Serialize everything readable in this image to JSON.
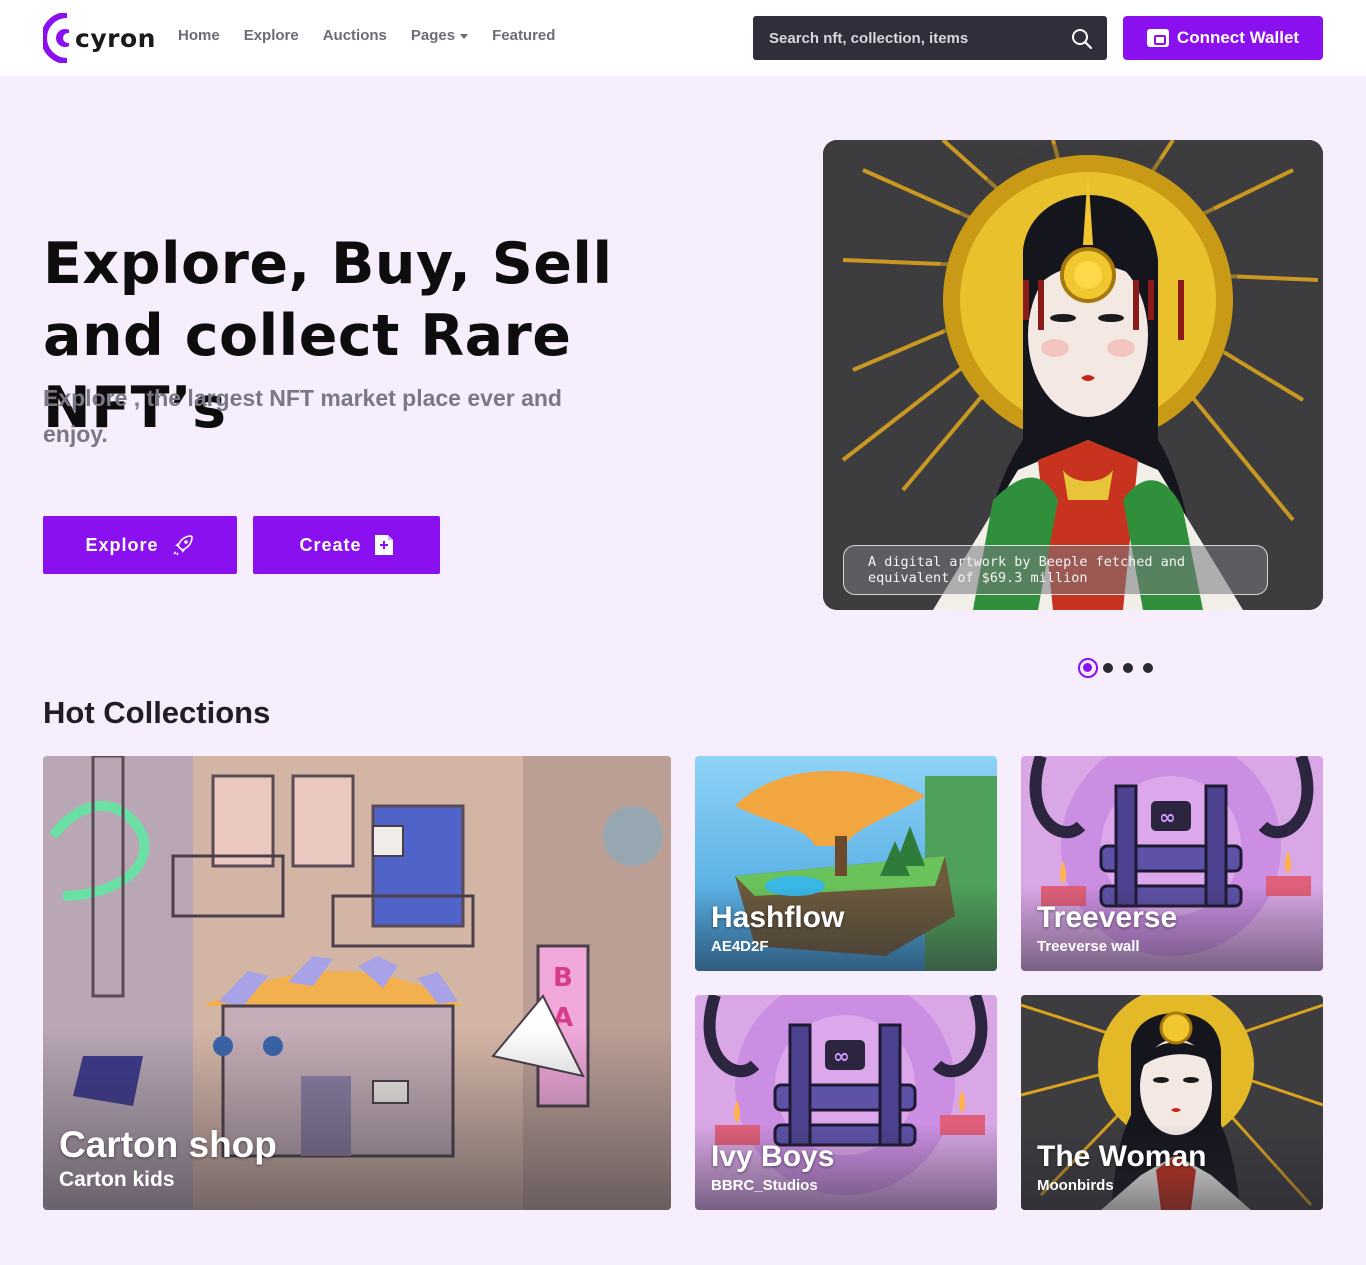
{
  "brand": {
    "name": "cyron",
    "accent": "#8a10f0"
  },
  "nav": {
    "items": [
      {
        "label": "Home"
      },
      {
        "label": "Explore"
      },
      {
        "label": "Auctions"
      },
      {
        "label": "Pages",
        "has_dropdown": true
      },
      {
        "label": "Featured"
      }
    ]
  },
  "search": {
    "placeholder": "Search nft, collection, items",
    "icon": "search-icon"
  },
  "wallet": {
    "label": "Connect Wallet",
    "icon": "wallet-icon"
  },
  "hero": {
    "title": "Explore, Buy, Sell and collect Rare NFT’s",
    "subtitle": "Explore , the largest NFT market place ever and enjoy.",
    "explore_label": "Explore",
    "create_label": "Create",
    "explore_icon": "rocket-icon",
    "create_icon": "add-file-icon",
    "caption": "A digital artwork by Beeple fetched and equivalent of $69.3 million",
    "slides_total": 4,
    "active_slide": 1
  },
  "collections": {
    "title": "Hot Collections",
    "cards": [
      {
        "title": "Carton shop",
        "subtitle": "Carton kids"
      },
      {
        "title": "Hashflow",
        "subtitle": "AE4D2F"
      },
      {
        "title": "Treeverse",
        "subtitle": "Treeverse wall"
      },
      {
        "title": "Ivy Boys",
        "subtitle": "BBRC_Studios"
      },
      {
        "title": "The Woman",
        "subtitle": "Moonbirds"
      }
    ]
  }
}
